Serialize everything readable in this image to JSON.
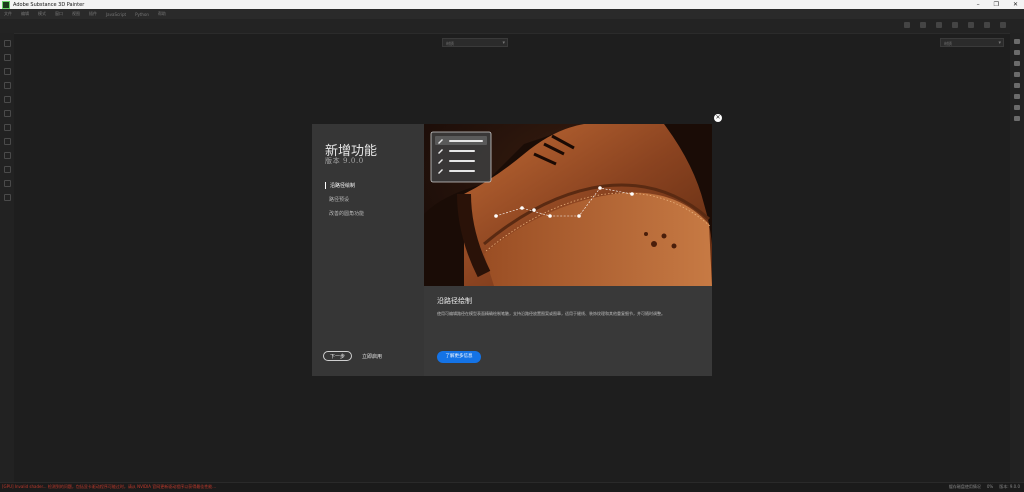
{
  "window": {
    "title": "Adobe Substance 3D Painter",
    "min": "–",
    "restore": "❐",
    "close": "✕"
  },
  "menu": [
    "文件",
    "编辑",
    "模式",
    "窗口",
    "视图",
    "插件",
    "JavaScript",
    "Python",
    "帮助"
  ],
  "viewport": {
    "left_select": "材质",
    "right_select": "材质"
  },
  "status": {
    "error": "[GPU] Invalid shader... 检测到的问题，包括显卡驱动程序可能过时，请从 NVIDIA 官网更新驱动程序以获得最佳性能...",
    "right": [
      "缓存磁盘使用情况",
      "0%",
      "版本: 9.0.0"
    ]
  },
  "dialog": {
    "heading": "新增功能",
    "version": "版本 9.0.0",
    "nav": [
      "沿路径绘制",
      "路径预设",
      "改善的圆角功能"
    ],
    "prev_button": "下一步",
    "start_button": "立即启用",
    "feature_title": "沿路径绘制",
    "feature_desc": "使用可编辑路径在模型表面精确绘制笔触，支持沿路径放置图案或图章，适用于缝线、装饰纹理和其他重复细节，并可随时调整。",
    "learn_more": "了解更多信息",
    "close_icon": "✕"
  }
}
